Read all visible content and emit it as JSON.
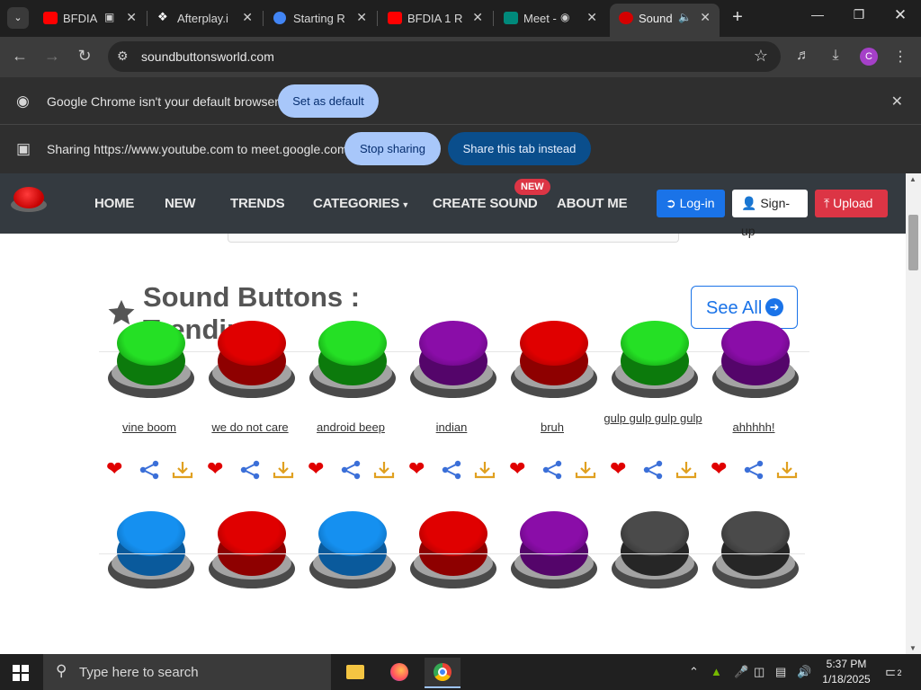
{
  "browser": {
    "tabs": [
      {
        "title": "BFDIA",
        "favicon": "youtube-icon",
        "favicon_color": "#ff0000"
      },
      {
        "title": "Afterplay.i",
        "favicon": "afterplay-icon",
        "favicon_color": "#ffffff"
      },
      {
        "title": "Starting R",
        "favicon": "chrome-web-icon",
        "favicon_color": "#4285f4"
      },
      {
        "title": "BFDIA 1 R",
        "favicon": "youtube-icon",
        "favicon_color": "#ff0000"
      },
      {
        "title": "Meet -",
        "favicon": "meet-icon",
        "favicon_color": "#00897b"
      },
      {
        "title": "Sound",
        "favicon": "red-button-icon",
        "favicon_color": "#d40000",
        "active": true
      }
    ],
    "url": "soundbuttonsworld.com",
    "infobars": {
      "default_browser": {
        "text": "Google Chrome isn't your default browser",
        "button": "Set as default"
      },
      "sharing": {
        "text": "Sharing https://www.youtube.com to meet.google.com",
        "stop_button": "Stop sharing",
        "share_tab_button": "Share this tab instead"
      }
    },
    "profile_initial": "C"
  },
  "site": {
    "nav": {
      "links": [
        "HOME",
        "NEW",
        "TRENDS",
        "CATEGORIES",
        "CREATE SOUND",
        "ABOUT ME"
      ],
      "badge": "NEW",
      "login": "Log-in",
      "signup": "Sign-up",
      "upload": "Upload"
    },
    "section": {
      "title": "Sound Buttons : Trending",
      "see_all": "See All"
    },
    "rows": [
      [
        {
          "label": "vine boom",
          "color": "green"
        },
        {
          "label": "we do not care",
          "color": "red"
        },
        {
          "label": "android beep",
          "color": "green"
        },
        {
          "label": "indian",
          "color": "purple"
        },
        {
          "label": "bruh",
          "color": "red"
        },
        {
          "label": "gulp gulp gulp gulp",
          "color": "green"
        },
        {
          "label": "ahhhhh!",
          "color": "purple"
        }
      ],
      [
        {
          "label": "",
          "color": "blue"
        },
        {
          "label": "",
          "color": "red"
        },
        {
          "label": "",
          "color": "blue"
        },
        {
          "label": "",
          "color": "red"
        },
        {
          "label": "",
          "color": "purple"
        },
        {
          "label": "",
          "color": "gray"
        },
        {
          "label": "",
          "color": "gray"
        }
      ]
    ],
    "button_colors": {
      "green": {
        "cap": "#25e025",
        "side": "#0c7a0c"
      },
      "red": {
        "cap": "#e00000",
        "side": "#8e0000"
      },
      "purple": {
        "cap": "#8a0da8",
        "side": "#54056a"
      },
      "blue": {
        "cap": "#1590f0",
        "side": "#0a5a9c"
      },
      "gray": {
        "cap": "#4a4a4a",
        "side": "#262626"
      }
    }
  },
  "taskbar": {
    "search_placeholder": "Type here to search",
    "time": "5:37 PM",
    "date": "1/18/2025",
    "notifications": "2"
  }
}
